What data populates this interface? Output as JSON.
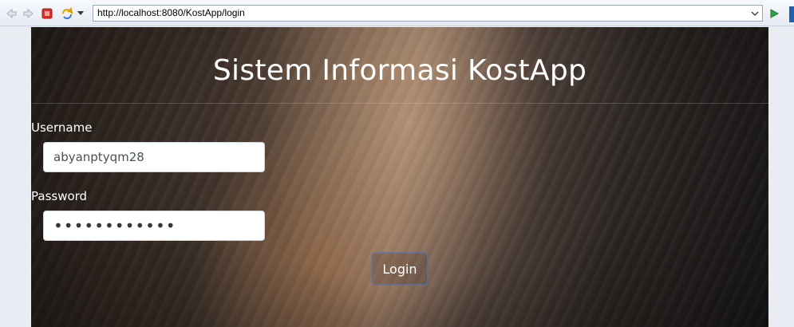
{
  "browser": {
    "url": "http://localhost:8080/KostApp/login",
    "icons": {
      "back": "back-arrow-icon",
      "forward": "forward-arrow-icon",
      "stop": "stop-icon",
      "refresh": "refresh-icon",
      "dropdown": "chevron-down-icon",
      "go": "play-go-icon"
    }
  },
  "page": {
    "title": "Sistem Informasi KostApp",
    "username_label": "Username",
    "username_value": "abyanptyqm28",
    "password_label": "Password",
    "password_value": "••••••••••••",
    "login_button": "Login"
  },
  "colors": {
    "stop_red": "#d9302a",
    "go_green": "#2ea043",
    "button_border": "#5a78c8"
  }
}
